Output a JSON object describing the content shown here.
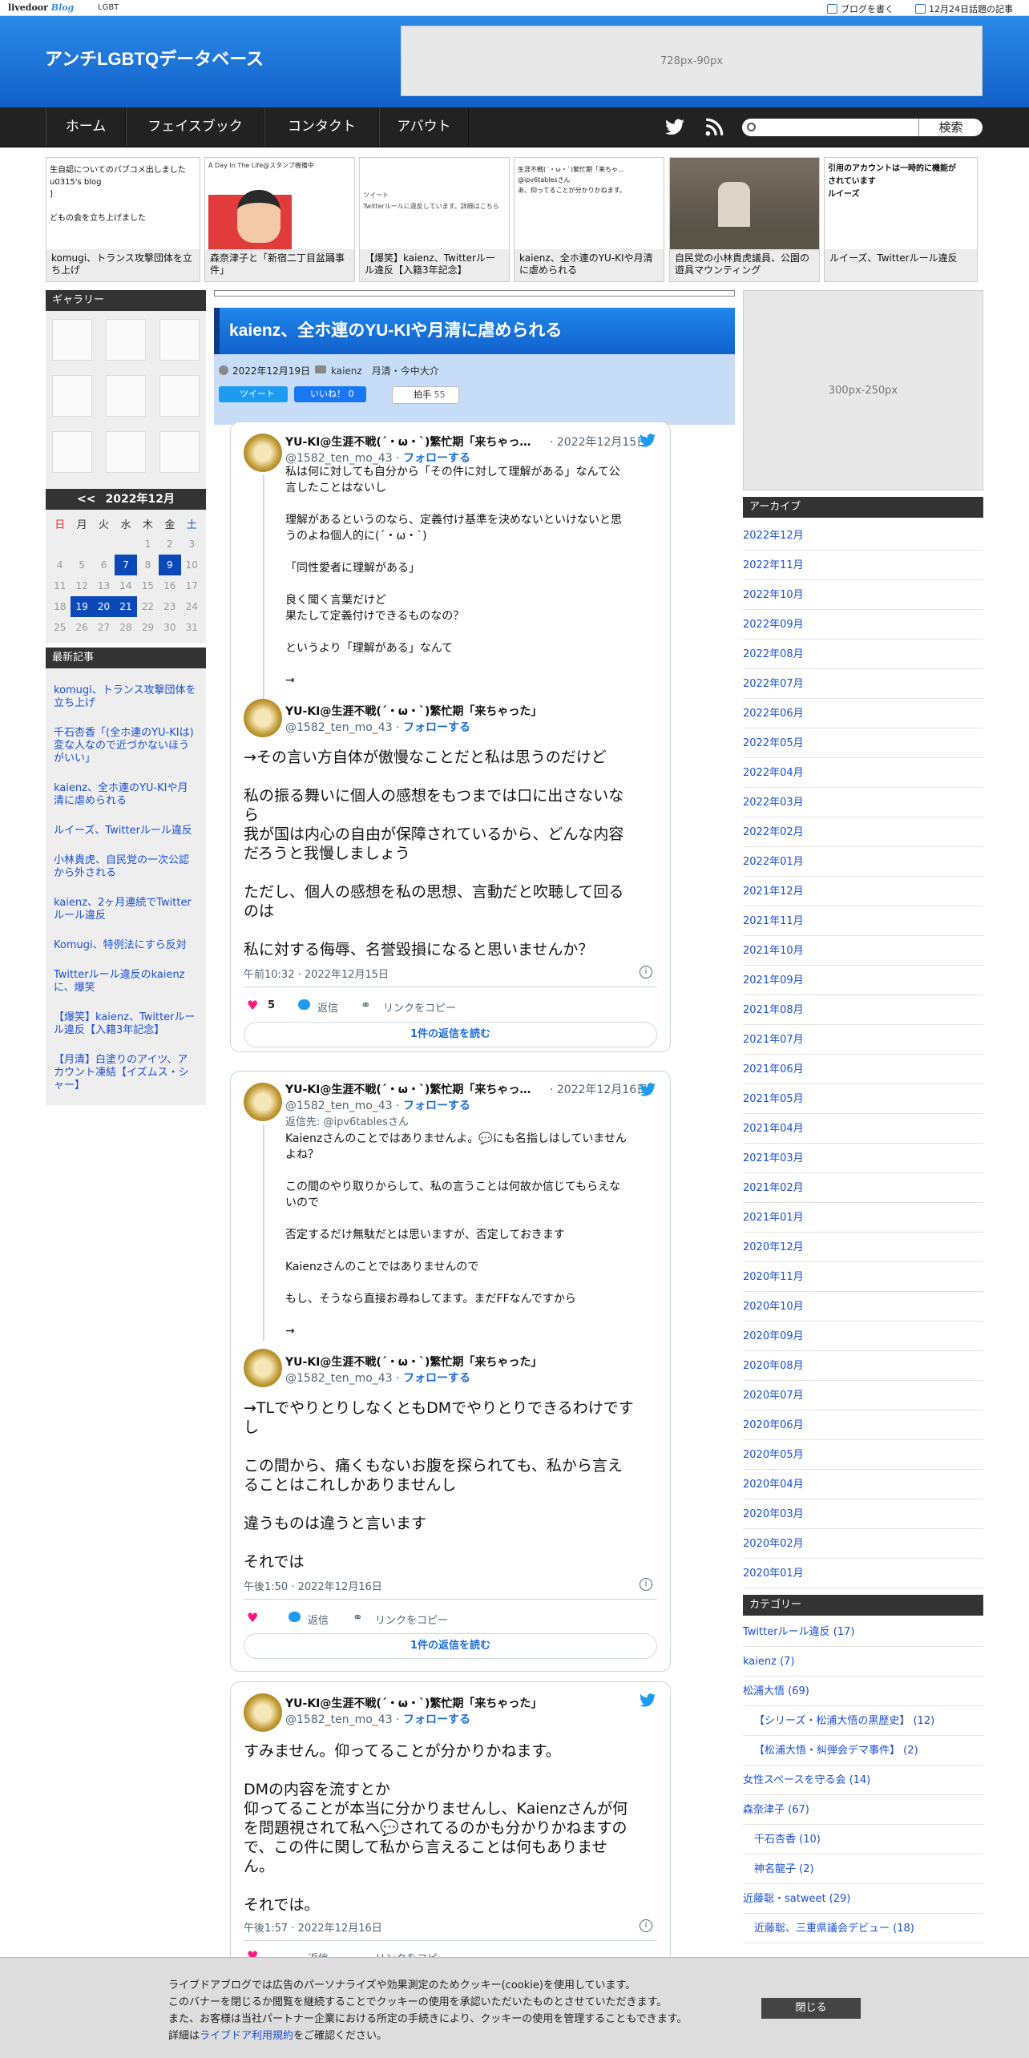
{
  "topbar": {
    "brand": "livedoor",
    "brand_blog": "Blog",
    "category": "LGBT",
    "write_blog": "ブログを書く",
    "trending": "12月24日話題の記事"
  },
  "header": {
    "site_title": "アンチLGBTQデータベース",
    "banner_ad": "728px-90px"
  },
  "nav": {
    "items": [
      "ホーム",
      "フェイスブック",
      "コンタクト",
      "アバウト"
    ],
    "search_button": "検索",
    "search_placeholder": ""
  },
  "carousel": [
    {
      "caption": "komugi、トランス攻撃団体を立ち上げ",
      "thumb_text": "生自認についてのパブコメ出しました\nu0315's blog\n]\n\nどもの会を立ち上げました"
    },
    {
      "caption": "森奈津子と「新宿二丁目盆踊事件」",
      "thumb_text": "A Day In The Life@スタンプ機備中"
    },
    {
      "caption": "【爆笑】kaienz、Twitterルール違反【入籍3年記念】",
      "thumb_text": "ツイート\nTwitterルールに違反しています。詳細はこちら"
    },
    {
      "caption": "kaienz、全ホ連のYU-KIや月清に虐められる",
      "thumb_text": "生涯不戦(´・ω・`)繁忙期「来ちゃ…\n@ipv6tablesさん\nあ、仰ってることが分かりかねます。"
    },
    {
      "caption": "自民党の小林貴虎議員、公園の遊具マウンティング",
      "thumb_text": ""
    },
    {
      "caption": "ルイーズ、Twitterルール違反",
      "thumb_text": "引用のアカウントは一時的に機能が\nされています\nルイーズ"
    }
  ],
  "left": {
    "gallery_title": "ギャラリー",
    "calendar": {
      "prev": "<<",
      "month": "2022年12月",
      "weekdays": [
        "日",
        "月",
        "火",
        "水",
        "木",
        "金",
        "土"
      ],
      "rows": [
        [
          "",
          "",
          "",
          "",
          "1",
          "2",
          "3"
        ],
        [
          "4",
          "5",
          "6",
          "7",
          "8",
          "9",
          "10"
        ],
        [
          "11",
          "12",
          "13",
          "14",
          "15",
          "16",
          "17"
        ],
        [
          "18",
          "19",
          "20",
          "21",
          "22",
          "23",
          "24"
        ],
        [
          "25",
          "26",
          "27",
          "28",
          "29",
          "30",
          "31"
        ]
      ],
      "highlighted": [
        "7",
        "9",
        "19",
        "20",
        "21"
      ]
    },
    "recent_title": "最新記事",
    "recent": [
      "komugi、トランス攻撃団体を立ち上げ",
      "千石杏香「(全ホ連のYU-KIは)変な人なので近づかないほうがいい」",
      "kaienz、全ホ連のYU-KIや月清に虐められる",
      "ルイーズ、Twitterルール違反",
      "小林貴虎、自民党の一次公認から外される",
      "kaienz、2ヶ月連続でTwitterルール違反",
      "Komugi、特例法にすら反対",
      "Twitterルール違反のkaienzに、爆笑",
      "【爆笑】kaienz、Twitterルール違反【入籍3年記念】",
      "【月清】白塗りのアイツ、アカウント凍結【イズムス・シャー】"
    ]
  },
  "post": {
    "title": "kaienz、全ホ連のYU-KIや月清に虐められる",
    "date": "2022年12月19日",
    "categories": "kaienz　月清・今中大介",
    "tweet_btn": "ツイート",
    "like_btn": "いいね！ 0",
    "clap_btn": "拍手",
    "clap_count": "55"
  },
  "tweets": [
    {
      "name": "YU-KI@生涯不戦(´・ω・`)繁忙期「来ちゃっ…",
      "date": "· 2022年12月15日",
      "handle": "@1582_ten_mo_43 · ",
      "follow": "フォローする",
      "quote_body": "私は何に対しても自分から「その件に対して理解がある」なんて公\n言したことはないし\n\n理解があるというのなら、定義付け基準を決めないといけないと思\nうのよね個人的に(´・ω・`)\n\n「同性愛者に理解がある」\n\n良く聞く言葉だけど\n果たして定義付けできるものなの？\n\nというより「理解がある」なんて\n\n→",
      "reply_name": "YU-KI@生涯不戦(´・ω・`)繁忙期「来ちゃった」",
      "main_text": "→その言い方自体が傲慢なことだと私は思うのだけど\n\n私の振る舞いに個人の感想をもつまでは口に出さないな\nら\n我が国は内心の自由が保障されているから、どんな内容\nだろうと我慢しましょう\n\nただし、個人の感想を私の思想、言動だと吹聴して回る\nのは\n\n私に対する侮辱、名誉毀損になると思いませんか？",
      "time": "午前10:32 · 2022年12月15日",
      "likes": "5",
      "reply": "返信",
      "copy": "リンクをコピー",
      "read": "1件の返信を読む"
    },
    {
      "name": "YU-KI@生涯不戦(´・ω・`)繁忙期「来ちゃっ…",
      "date": "· 2022年12月16日",
      "handle": "@1582_ten_mo_43 · ",
      "follow": "フォローする",
      "replying": "返信先: @ipv6tablesさん",
      "quote_body": "Kaienzさんのことではありませんよ。💬にも名指しはしていません\nよね？\n\nこの間のやり取りからして、私の言うことは何故か信じてもらえな\nいので\n\n否定するだけ無駄だとは思いますが、否定しておきます\n\nKaienzさんのことではありませんので\n\nもし、そうなら直接お尋ねしてます。まだFFなんですから\n\n→",
      "reply_name": "YU-KI@生涯不戦(´・ω・`)繁忙期「来ちゃった」",
      "main_text": "→TLでやりとりしなくともDMでやりとりできるわけです\nし\n\nこの間から、痛くもないお腹を探られても、私から言え\nることはこれしかありませんし\n\n違うものは違うと言います\n\nそれでは",
      "time": "午後1:50 · 2022年12月16日",
      "reply": "返信",
      "copy": "リンクをコピー",
      "read": "1件の返信を読む"
    },
    {
      "name": "YU-KI@生涯不戦(´・ω・`)繁忙期「来ちゃった」",
      "handle": "@1582_ten_mo_43 · ",
      "follow": "フォローする",
      "main_text": "すみません。仰ってることが分かりかねます。\n\nDMの内容を流すとか\n仰ってることが本当に分かりませんし、Kaienzさんが何\nを問題視されて私へ💬されてるのかも分かりかねますの\nで、この件に関して私から言えることは何もありませ\nん。\n\nそれでは。",
      "time": "午後1:57 · 2022年12月16日",
      "reply": "返信",
      "copy": "リンクをコピー"
    }
  ],
  "right": {
    "ad": "300px-250px",
    "archive_title": "アーカイブ",
    "archive": [
      "2022年12月",
      "2022年11月",
      "2022年10月",
      "2022年09月",
      "2022年08月",
      "2022年07月",
      "2022年06月",
      "2022年05月",
      "2022年04月",
      "2022年03月",
      "2022年02月",
      "2022年01月",
      "2021年12月",
      "2021年11月",
      "2021年10月",
      "2021年09月",
      "2021年08月",
      "2021年07月",
      "2021年06月",
      "2021年05月",
      "2021年04月",
      "2021年03月",
      "2021年02月",
      "2021年01月",
      "2020年12月",
      "2020年11月",
      "2020年10月",
      "2020年09月",
      "2020年08月",
      "2020年07月",
      "2020年06月",
      "2020年05月",
      "2020年04月",
      "2020年03月",
      "2020年02月",
      "2020年01月"
    ],
    "category_title": "カテゴリー",
    "categories": [
      {
        "label": "Twitterルール違反 (17)",
        "sub": false
      },
      {
        "label": "kaienz (7)",
        "sub": false
      },
      {
        "label": "松浦大悟 (69)",
        "sub": false
      },
      {
        "label": "【シリーズ・松浦大悟の黒歴史】 (12)",
        "sub": true
      },
      {
        "label": "【松浦大悟・糾弾会デマ事件】 (2)",
        "sub": true
      },
      {
        "label": "女性スペースを守る会 (14)",
        "sub": false
      },
      {
        "label": "森奈津子 (67)",
        "sub": false
      },
      {
        "label": "千石杏香 (10)",
        "sub": true
      },
      {
        "label": "神名龍子 (2)",
        "sub": true
      },
      {
        "label": "近藤聡・satweet (29)",
        "sub": false
      },
      {
        "label": "近藤聡、三重県議会デビュー (18)",
        "sub": true
      }
    ]
  },
  "cookie": {
    "lines": [
      "ライブドアブログでは広告のパーソナライズや効果測定のためクッキー(cookie)を使用しています。",
      "このバナーを閉じるか閲覧を継続することでクッキーの使用を承認いただいたものとさせていただきます。",
      "また、お客様は当社パートナー企業における所定の手続きにより、クッキーの使用を管理することもできます。"
    ],
    "detail_pre": "詳細は",
    "detail_link": "ライブドア利用規約",
    "detail_post": "をご確認ください。",
    "close": "閉じる"
  },
  "colors": {
    "accent": "#1a73e8",
    "header": "#1f7de0",
    "nav": "#222222",
    "like": "#f91880",
    "link": "#1a4fd0"
  }
}
